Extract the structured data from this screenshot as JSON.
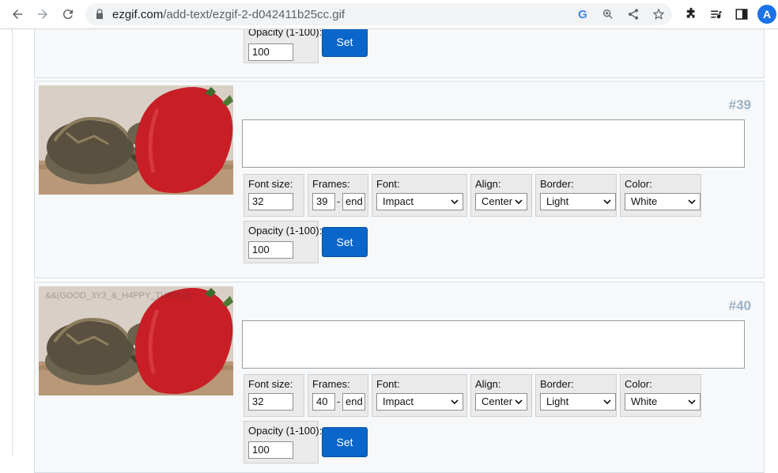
{
  "browser": {
    "url_host": "ezgif.com",
    "url_path": "/add-text/ezgif-2-d042411b25cc.gif",
    "avatar_letter": "A",
    "google_icon_glyph": "G"
  },
  "labels": {
    "font_size": "Font size:",
    "frames": "Frames:",
    "font": "Font:",
    "align": "Align:",
    "border": "Border:",
    "color": "Color:",
    "opacity": "Opacity (1-100):",
    "opacity_partial": "Opacity (1-100):",
    "set": "Set",
    "dash": "-"
  },
  "top_partial": {
    "opacity_value": "100"
  },
  "frames": [
    {
      "number": "#39",
      "font_size": "32",
      "frame_start": "39",
      "frame_end": "end",
      "font": "Impact",
      "align": "Center",
      "border": "Light",
      "color": "White",
      "opacity": "100",
      "overlay_text": ""
    },
    {
      "number": "#40",
      "font_size": "32",
      "frame_start": "40",
      "frame_end": "end",
      "font": "Impact",
      "align": "Center",
      "border": "Light",
      "color": "White",
      "opacity": "100",
      "overlay_text": "&&(GOOD_3Y3_&_H4PPY_TUR7L3)"
    }
  ],
  "colors": {
    "set_button": "#0a66c8",
    "frame_number": "#9cb2c6",
    "panel_bg": "#f6f8fa"
  }
}
